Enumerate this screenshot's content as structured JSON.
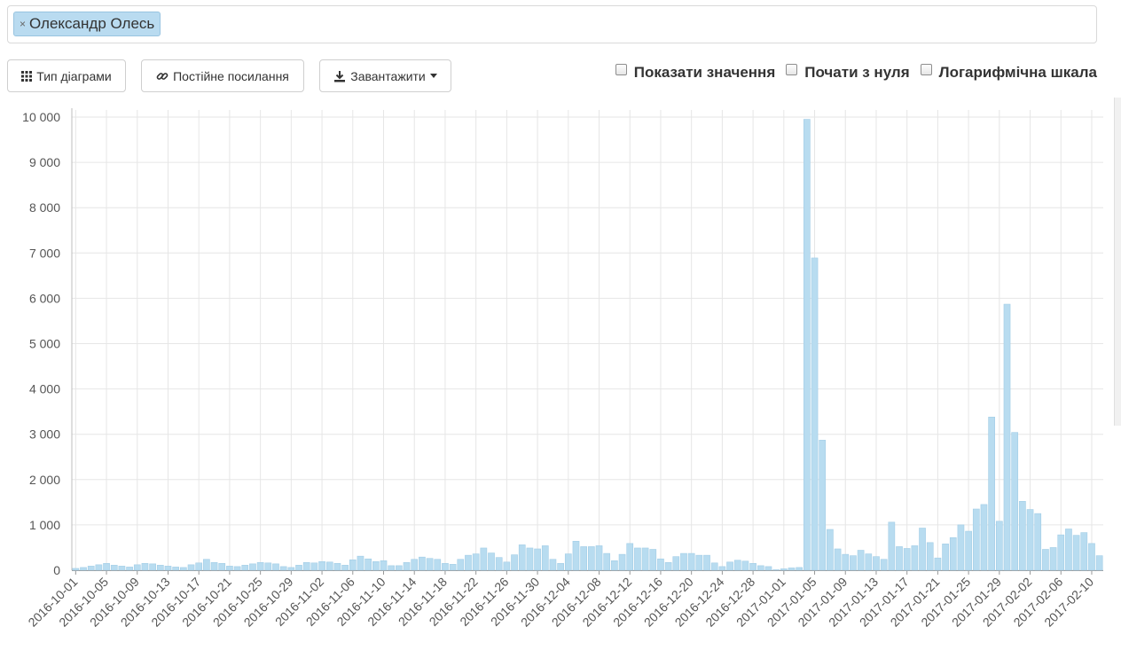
{
  "filter": {
    "tag_label": "Олександр Олесь",
    "remove_icon": "×"
  },
  "toolbar": {
    "chart_type_label": "Тип діаграми",
    "permalink_label": "Постійне посилання",
    "download_label": "Завантажити",
    "chart_type_icon": "grid-icon",
    "permalink_icon": "link-icon",
    "download_icon": "download-icon"
  },
  "options": {
    "show_values_label": "Показати значення",
    "start_zero_label": "Почати з нуля",
    "log_scale_label": "Логарифмічна шкала",
    "show_values_checked": false,
    "start_zero_checked": false,
    "log_scale_checked": false
  },
  "colors": {
    "bar_fill": "#b8dcf0",
    "bar_stroke": "#a2cde6",
    "grid": "#e6e6e6"
  },
  "chart_data": {
    "type": "bar",
    "x_start": "2016-10-01",
    "x_end": "2017-02-11",
    "tick_step_days": 4,
    "x_tick_labels": [
      "2016-10-01",
      "2016-10-05",
      "2016-10-09",
      "2016-10-13",
      "2016-10-17",
      "2016-10-21",
      "2016-10-25",
      "2016-10-29",
      "2016-11-02",
      "2016-11-06",
      "2016-11-10",
      "2016-11-14",
      "2016-11-18",
      "2016-11-22",
      "2016-11-26",
      "2016-11-30",
      "2016-12-04",
      "2016-12-08",
      "2016-12-12",
      "2016-12-16",
      "2016-12-20",
      "2016-12-24",
      "2016-12-28",
      "2017-01-01",
      "2017-01-05",
      "2017-01-09",
      "2017-01-13",
      "2017-01-17",
      "2017-01-21",
      "2017-01-25",
      "2017-01-29",
      "2017-02-02",
      "2017-02-06",
      "2017-02-10"
    ],
    "y_ticks": [
      "0",
      "1 000",
      "2 000",
      "3 000",
      "4 000",
      "5 000",
      "6 000",
      "7 000",
      "8 000",
      "9 000",
      "10 000"
    ],
    "ylim": [
      0,
      10000
    ],
    "grid": true,
    "values": [
      40,
      60,
      90,
      120,
      150,
      110,
      90,
      70,
      120,
      150,
      140,
      110,
      90,
      70,
      60,
      120,
      160,
      240,
      170,
      150,
      90,
      80,
      110,
      140,
      170,
      160,
      140,
      80,
      60,
      110,
      170,
      160,
      190,
      180,
      150,
      110,
      230,
      310,
      250,
      190,
      210,
      100,
      100,
      170,
      240,
      290,
      260,
      240,
      150,
      130,
      240,
      330,
      360,
      490,
      380,
      280,
      180,
      340,
      560,
      490,
      470,
      540,
      240,
      150,
      360,
      640,
      520,
      520,
      540,
      370,
      210,
      350,
      590,
      490,
      490,
      460,
      250,
      170,
      300,
      370,
      370,
      330,
      330,
      160,
      80,
      180,
      220,
      200,
      150,
      100,
      80,
      10,
      30,
      50,
      60,
      9950,
      6890,
      2870,
      900,
      470,
      350,
      320,
      440,
      360,
      300,
      240,
      1060,
      520,
      480,
      540,
      930,
      610,
      270,
      580,
      720,
      1000,
      860,
      1350,
      1450,
      3380,
      1080,
      5870,
      3040,
      1520,
      1340,
      1250,
      460,
      500,
      780,
      910,
      770,
      830,
      590,
      320
    ]
  }
}
